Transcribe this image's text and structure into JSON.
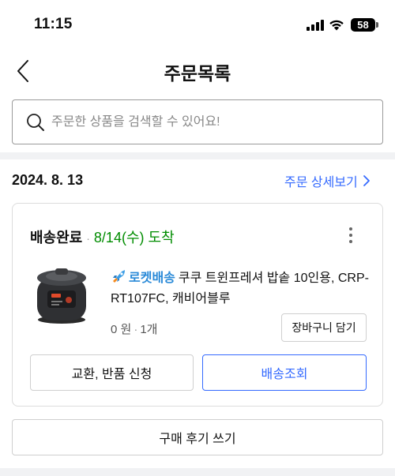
{
  "status_bar": {
    "time": "11:15",
    "battery": "58"
  },
  "nav": {
    "title": "주문목록"
  },
  "search": {
    "placeholder": "주문한 상품을 검색할 수 있어요!"
  },
  "order": {
    "date": "2024. 8. 13",
    "detail_link": "주문 상세보기",
    "status": "배송완료",
    "delivery_date": "8/14(수) 도착",
    "product": {
      "rocket_label": "로켓배송",
      "title": "쿠쿠 트윈프레셔 밥솥 10인용, CRP-RT107FC, 캐비어블루",
      "price": "0 원",
      "quantity": "1개"
    },
    "cart_button": "장바구니 담기",
    "exchange_button": "교환, 반품 신청",
    "track_button": "배송조회",
    "review_button": "구매 후기 쓰기"
  },
  "colors": {
    "accent": "#346aff",
    "delivered": "#008c00",
    "rocket": "#2a8ad8"
  }
}
